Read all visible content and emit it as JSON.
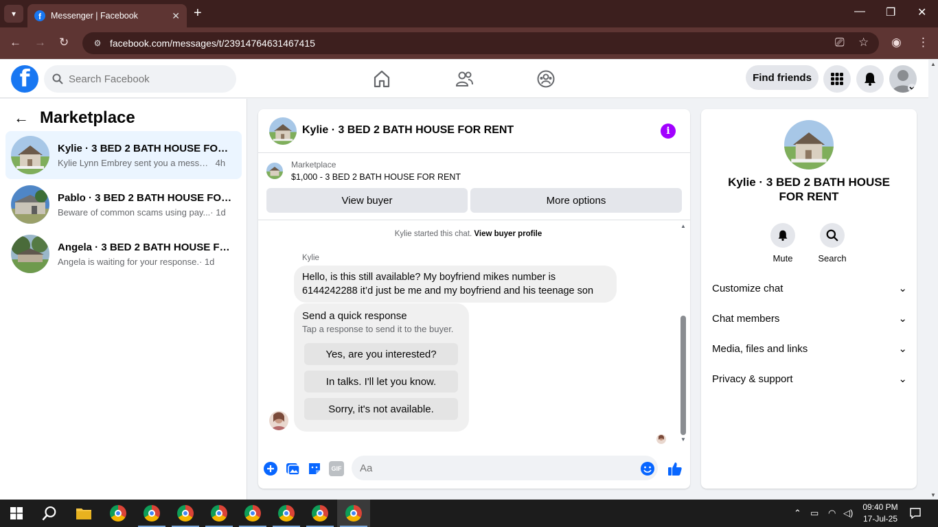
{
  "browser": {
    "tab_title": "Messenger | Facebook",
    "url": "facebook.com/messages/t/23914764631467415"
  },
  "fb_header": {
    "search_placeholder": "Search Facebook",
    "find_friends": "Find friends"
  },
  "sidebar": {
    "title": "Marketplace",
    "conversations": [
      {
        "name": "Kylie · 3 BED 2 BATH HOUSE FOR RENT",
        "snippet": "Kylie Lynn Embrey sent you a messag...",
        "time": "4h"
      },
      {
        "name": "Pablo · 3 BED 2 BATH HOUSE FOR RENT",
        "snippet": "Beware of common scams using pay...",
        "time": " · 1d"
      },
      {
        "name": "Angela · 3 BED 2 BATH HOUSE FOR RENT",
        "snippet": "Angela is waiting for your response.",
        "time": " · 1d"
      }
    ]
  },
  "chat": {
    "title": "Kylie · 3 BED 2 BATH HOUSE FOR RENT",
    "marketplace_label": "Marketplace",
    "listing": "$1,000 - 3 BED 2 BATH HOUSE FOR RENT",
    "view_buyer": "View buyer",
    "more_options": "More options",
    "started_text": "Kylie started this chat.",
    "view_buyer_profile": "View buyer profile",
    "sender": "Kylie",
    "message": "Hello, is this still available? My boyfriend mikes number is 6144242288 it’d just be me and my boyfriend and his teenage son",
    "quick_title": "Send a quick response",
    "quick_subtitle": "Tap a response to send it to the buyer.",
    "quick_responses": [
      "Yes, are you interested?",
      "In talks. I'll let you know.",
      "Sorry, it's not available."
    ],
    "composer_placeholder": "Aa",
    "gif_label": "GIF"
  },
  "details": {
    "title": "Kylie · 3 BED 2 BATH HOUSE FOR RENT",
    "mute": "Mute",
    "search": "Search",
    "sections": [
      "Customize chat",
      "Chat members",
      "Media, files and links",
      "Privacy & support"
    ]
  },
  "taskbar": {
    "time": "09:40 PM",
    "date": "17-Jul-25"
  },
  "colors": {
    "fb_blue": "#1877f2",
    "browser_frame": "#3c1f1e",
    "active_conv_bg": "#ebf5ff",
    "info_purple": "#a100ff"
  }
}
